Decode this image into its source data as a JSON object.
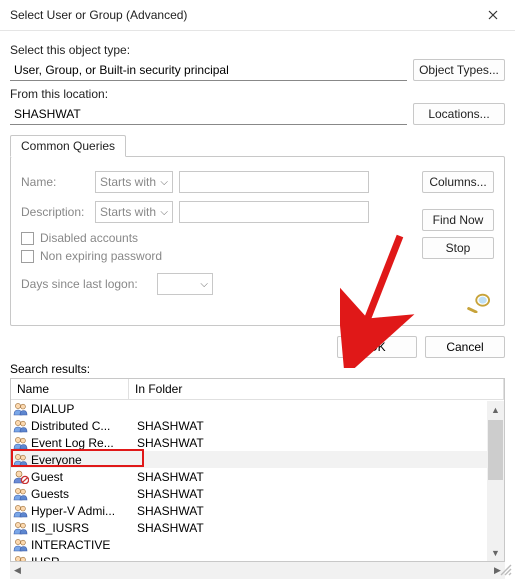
{
  "title": "Select User or Group (Advanced)",
  "labels": {
    "objectType": "Select this object type:",
    "fromLocation": "From this location:",
    "commonQueries": "Common Queries",
    "name": "Name:",
    "description": "Description:",
    "disabledAccounts": "Disabled accounts",
    "nonExpiring": "Non expiring password",
    "daysSince": "Days since last logon:",
    "searchResults": "Search results:",
    "colName": "Name",
    "colFolder": "In Folder"
  },
  "values": {
    "objectType": "User, Group, or Built-in security principal",
    "location": "SHASHWAT",
    "nameCombo": "Starts with",
    "descCombo": "Starts with"
  },
  "buttons": {
    "objectTypes": "Object Types...",
    "locations": "Locations...",
    "columns": "Columns...",
    "findNow": "Find Now",
    "stop": "Stop",
    "ok": "OK",
    "cancel": "Cancel"
  },
  "results": [
    {
      "name": "DIALUP",
      "folder": "",
      "icon": "group"
    },
    {
      "name": "Distributed C...",
      "folder": "SHASHWAT",
      "icon": "group"
    },
    {
      "name": "Event Log Re...",
      "folder": "SHASHWAT",
      "icon": "group"
    },
    {
      "name": "Everyone",
      "folder": "",
      "icon": "group",
      "selected": true
    },
    {
      "name": "Guest",
      "folder": "SHASHWAT",
      "icon": "user-disabled"
    },
    {
      "name": "Guests",
      "folder": "SHASHWAT",
      "icon": "group"
    },
    {
      "name": "Hyper-V Admi...",
      "folder": "SHASHWAT",
      "icon": "group"
    },
    {
      "name": "IIS_IUSRS",
      "folder": "SHASHWAT",
      "icon": "group"
    },
    {
      "name": "INTERACTIVE",
      "folder": "",
      "icon": "group"
    },
    {
      "name": "IUSR",
      "folder": "",
      "icon": "group"
    }
  ]
}
